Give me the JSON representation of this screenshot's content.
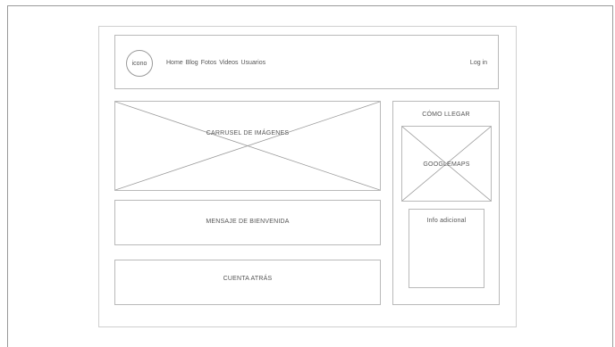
{
  "header": {
    "logo": "icono",
    "nav": [
      "Home",
      "Blog",
      "Fotos",
      "Videos",
      "Usuarios"
    ],
    "login": "Log in"
  },
  "main": {
    "carousel": "CARRUSEL DE IMÁGENES",
    "welcome": "MENSAJE DE BIENVENIDA",
    "countdown": "CUENTA ATRÁS"
  },
  "sidebar": {
    "title": "CÓMO LLEGAR",
    "map": "GOOGLEMAPS",
    "info": "Info adicional"
  }
}
